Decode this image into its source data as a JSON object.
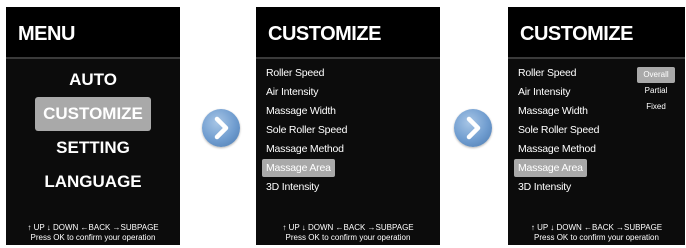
{
  "screens": {
    "menu": {
      "title": "MENU",
      "items": [
        {
          "label": "AUTO"
        },
        {
          "label": "CUSTOMIZE"
        },
        {
          "label": "SETTING"
        },
        {
          "label": "LANGUAGE"
        }
      ],
      "selected_index": 1
    },
    "customize": {
      "title": "CUSTOMIZE",
      "options": [
        {
          "label": "Roller Speed"
        },
        {
          "label": "Air Intensity"
        },
        {
          "label": "Massage Width"
        },
        {
          "label": "Sole Roller Speed"
        },
        {
          "label": "Massage Method"
        },
        {
          "label": "Massage Area"
        },
        {
          "label": "3D Intensity"
        }
      ],
      "selected_index": 5
    },
    "customize_area": {
      "title": "CUSTOMIZE",
      "submenu": [
        {
          "label": "Overall"
        },
        {
          "label": "Partial"
        },
        {
          "label": "Fixed"
        }
      ],
      "submenu_selected_index": 0
    }
  },
  "footer": {
    "nav_hint": "↑ UP ↓ DOWN ←BACK →SUBPAGE",
    "confirm_hint": "Press OK to confirm your operation"
  },
  "icons": {
    "arrow": "chevron-right-icon"
  },
  "colors": {
    "screen_bg": "#0c0c0c",
    "highlight": "#a9a9a9",
    "arrow_button": "#6f9ccf"
  }
}
